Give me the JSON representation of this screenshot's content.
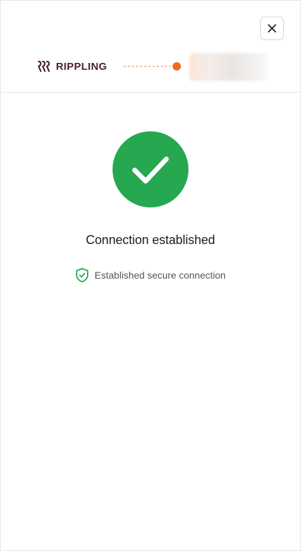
{
  "header": {
    "brand_name": "RIPPLING",
    "brand_color": "#4a2236",
    "connector_color": "#f26a21"
  },
  "controls": {
    "close_icon": "close-icon"
  },
  "status": {
    "title": "Connection established",
    "secure_text": "Established secure connection",
    "success_color": "#25a850",
    "success_icon": "checkmark-icon",
    "secure_icon": "shield-check-icon"
  }
}
